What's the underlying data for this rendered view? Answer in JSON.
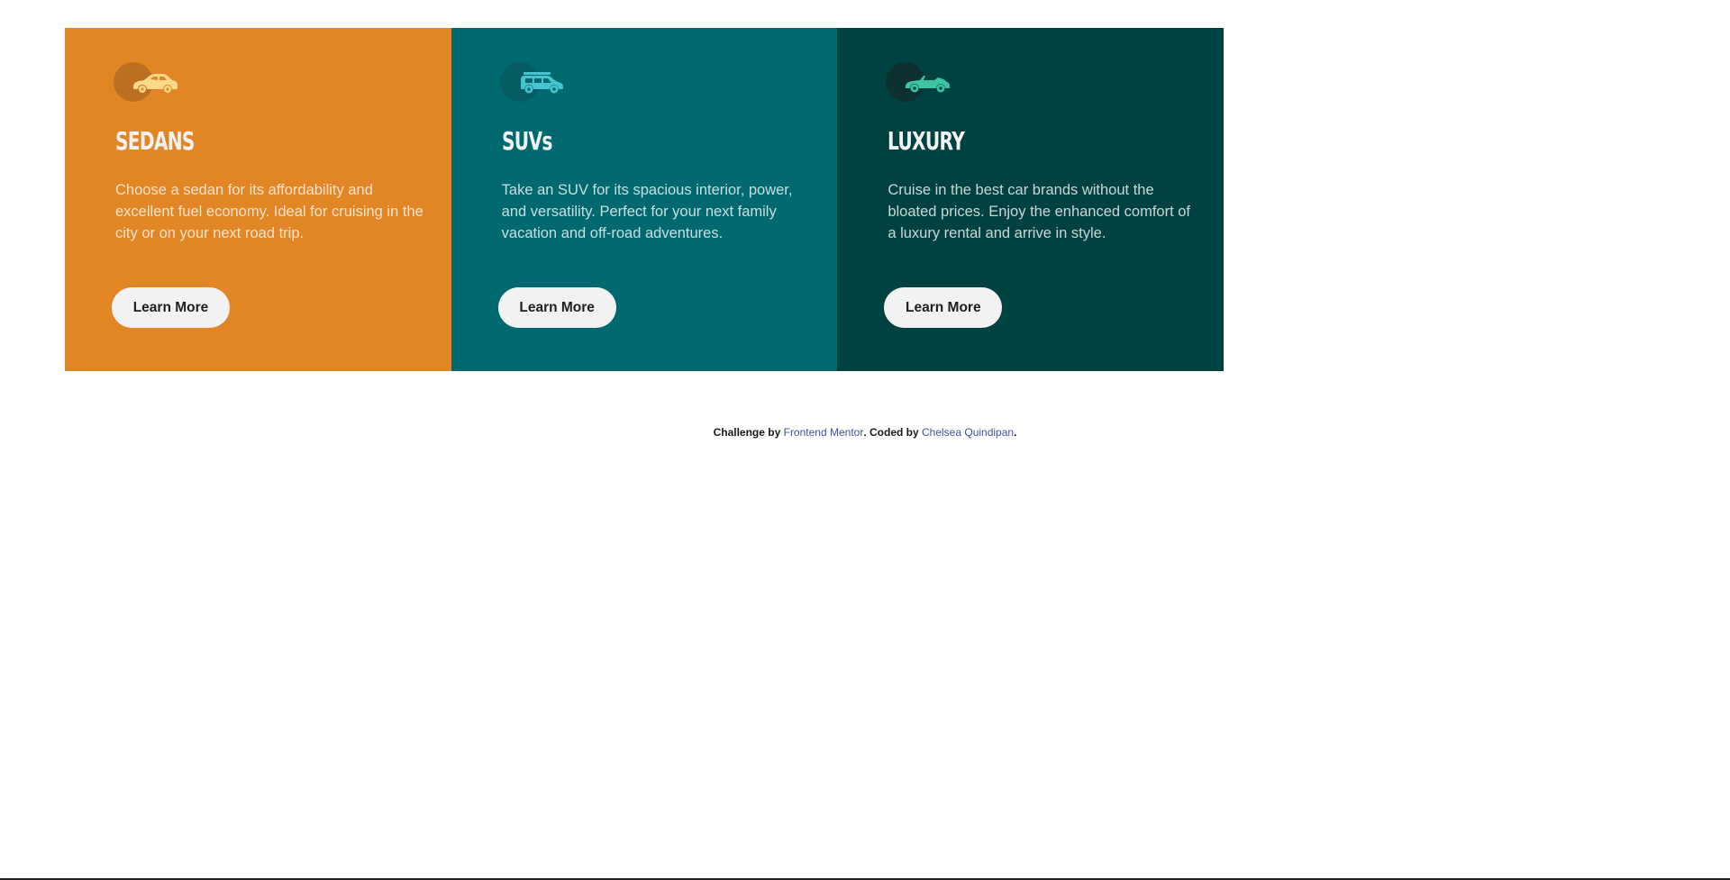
{
  "cards": [
    {
      "key": "sedans",
      "title": "SEDANS",
      "text": "Choose a sedan for its affordability and excellent fuel economy. Ideal for cruising in the city or on your next road trip.",
      "button": "Learn More",
      "icon": "sedan-car-icon",
      "color": "#e28625",
      "icon_color": "#ffd98a"
    },
    {
      "key": "suvs",
      "title": "SUVs",
      "text": "Take an SUV for its spacious interior, power, and versatility. Perfect for your next family vacation and off-road adventures.",
      "button": "Learn More",
      "icon": "suv-car-icon",
      "color": "#006970",
      "icon_color": "#46c5d1"
    },
    {
      "key": "luxury",
      "title": "LUXURY",
      "text": "Cruise in the best car brands without the bloated prices. Enjoy the enhanced comfort of a luxury rental and arrive in style.",
      "button": "Learn More",
      "icon": "luxury-car-icon",
      "color": "#004241",
      "icon_color": "#3cc4a3"
    }
  ],
  "attribution": {
    "prefix": "Challenge by ",
    "link1": "Frontend Mentor",
    "middle": ". Coded by ",
    "link2": "Chelsea Quindipan",
    "suffix": "."
  }
}
